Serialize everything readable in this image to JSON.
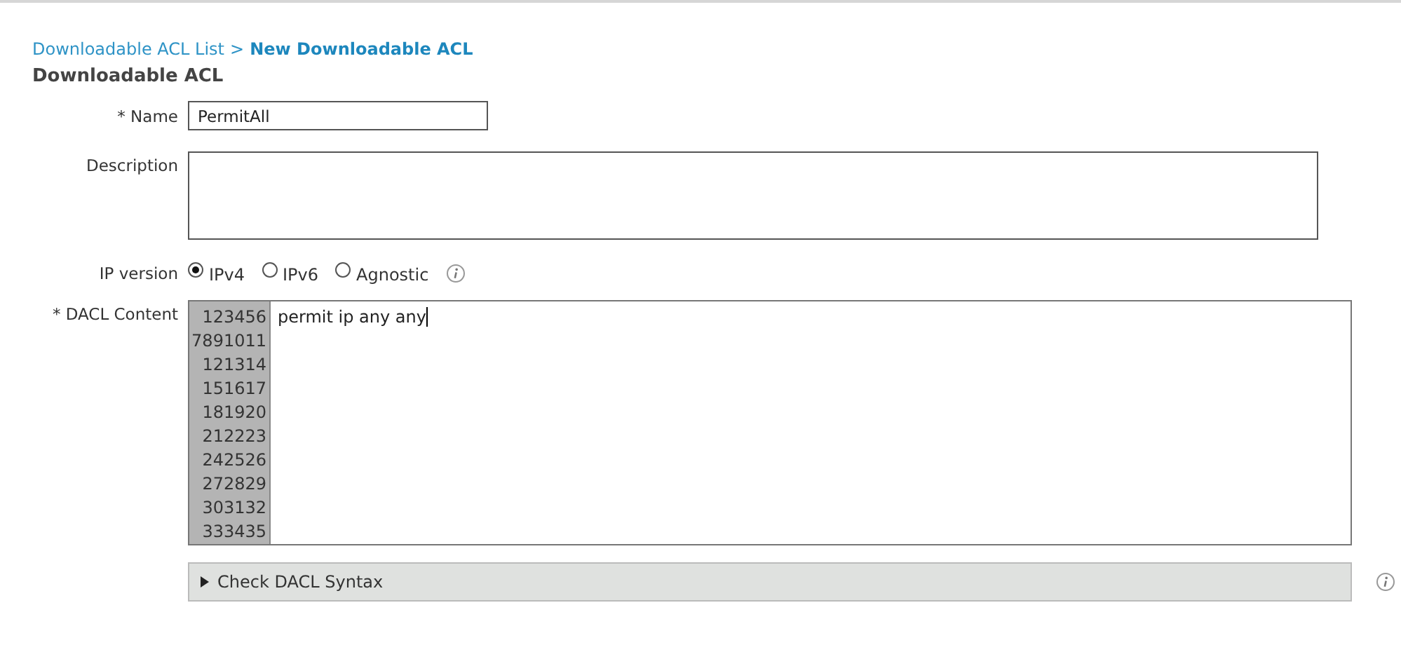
{
  "breadcrumb": {
    "parent": "Downloadable ACL List",
    "separator": ">",
    "current": "New Downloadable ACL"
  },
  "heading": "Downloadable ACL",
  "name_field": {
    "label": "* Name",
    "value": "PermitAll"
  },
  "description_field": {
    "label": "Description"
  },
  "ip_version": {
    "label": "IP version",
    "options": [
      {
        "label": "IPv4",
        "selected": true
      },
      {
        "label": "IPv6",
        "selected": false
      },
      {
        "label": "Agnostic",
        "selected": false
      }
    ]
  },
  "dacl_content": {
    "label": "* DACL Content",
    "line_numbers": [
      "123456",
      "7891011",
      "121314",
      "151617",
      "181920",
      "212223",
      "242526",
      "272829",
      "303132",
      "333435"
    ],
    "value": "permit ip any any"
  },
  "check_syntax": {
    "label": "Check DACL Syntax",
    "expanded": false
  }
}
